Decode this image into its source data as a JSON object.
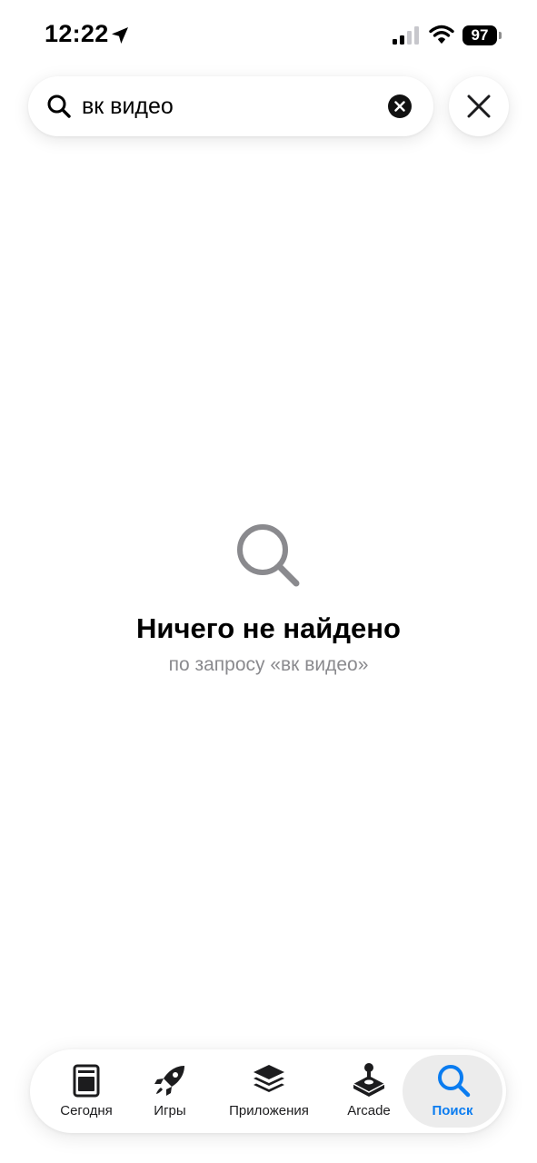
{
  "status_bar": {
    "time": "12:22",
    "battery": "97",
    "icons": [
      "location-arrow-icon",
      "cellular-signal-icon",
      "wifi-icon",
      "battery-icon"
    ]
  },
  "search": {
    "query": "вк видео",
    "icons": {
      "search": "search-icon",
      "clear": "clear-circle-icon",
      "close": "close-icon"
    }
  },
  "empty_state": {
    "icon": "magnifier-icon",
    "title": "Ничего не найдено",
    "subtitle": "по запросу «вк видео»"
  },
  "tab_bar": {
    "tabs": [
      {
        "label": "Сегодня",
        "icon": "today-icon"
      },
      {
        "label": "Игры",
        "icon": "rocket-icon"
      },
      {
        "label": "Приложения",
        "icon": "apps-stack-icon"
      },
      {
        "label": "Arcade",
        "icon": "joystick-icon"
      },
      {
        "label": "Поиск",
        "icon": "search-icon"
      }
    ],
    "selected_index": 4
  },
  "colors": {
    "accent": "#0A7CF0",
    "secondary_text": "#8A8A8E",
    "selected_tab_bg": "#ECECEC"
  }
}
